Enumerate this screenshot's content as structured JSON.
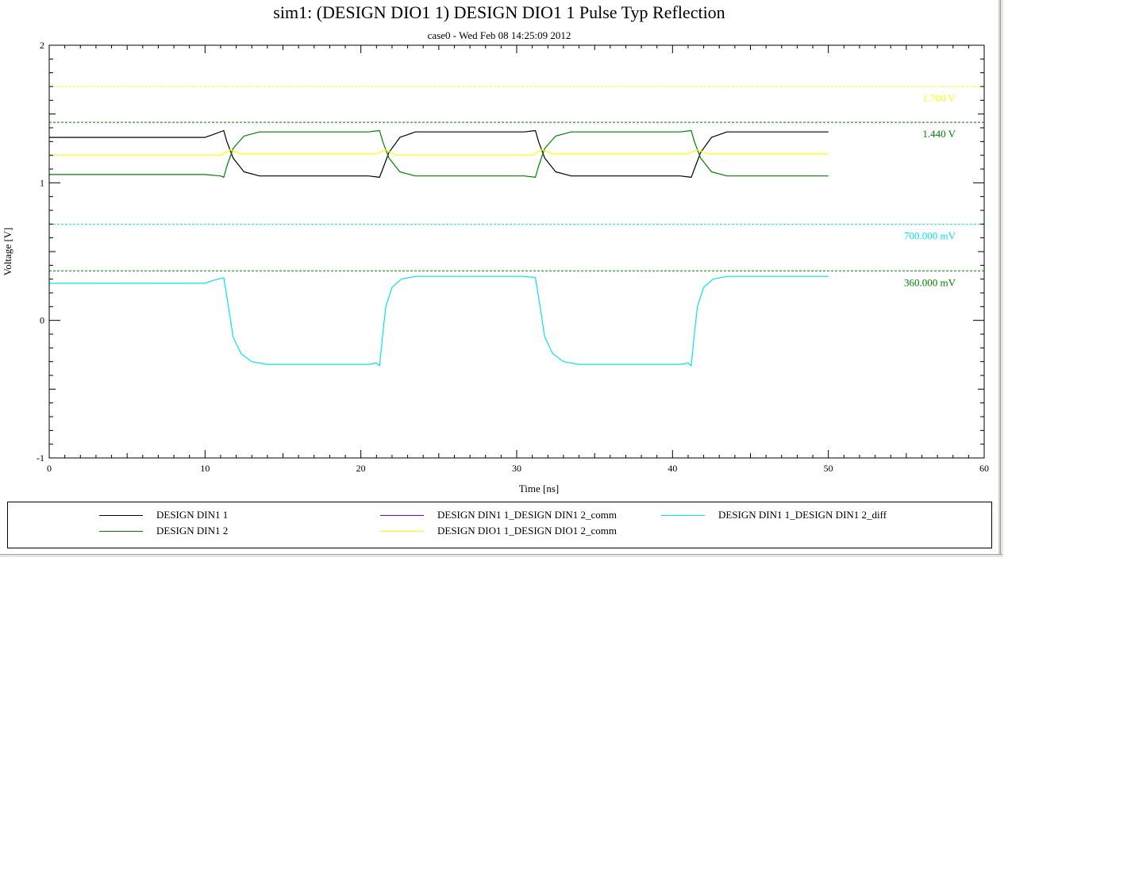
{
  "window": {
    "title": "sim1: (DESIGN DIO1 1) DESIGN DIO1 1 Pulse Typ Reflection",
    "subtitle": "case0 - Wed Feb 08 14:25:09 2012"
  },
  "chart_data": {
    "type": "line",
    "title": "sim1: (DESIGN DIO1 1) DESIGN DIO1 1 Pulse Typ Reflection",
    "subtitle": "case0 - Wed Feb 08 14:25:09 2012",
    "xlabel": "Time [ns]",
    "ylabel": "Voltage [V]",
    "xlim": [
      0,
      60
    ],
    "ylim": [
      -1,
      2
    ],
    "xticks": [
      0,
      10,
      20,
      30,
      40,
      50,
      60
    ],
    "yticks": [
      -1,
      0,
      1,
      2
    ],
    "grid": false,
    "legend_position": "bottom",
    "thresholds": [
      {
        "value": 1.7,
        "label": "1.700 V",
        "color": "#ffff00"
      },
      {
        "value": 1.44,
        "label": "1.440 V",
        "color": "#008000"
      },
      {
        "value": 0.7,
        "label": "700.000 mV",
        "color": "#00e5ee"
      },
      {
        "value": 0.36,
        "label": "360.000 mV",
        "color": "#008000"
      }
    ],
    "series": [
      {
        "name": "DESIGN DIN1 1",
        "color": "#000000",
        "x": [
          0,
          10,
          10.5,
          11.2,
          11.4,
          11.8,
          12.5,
          13.5,
          20.5,
          21.2,
          21.4,
          21.8,
          22.5,
          23.5,
          30.5,
          31.2,
          31.4,
          31.8,
          32.5,
          33.5,
          40.5,
          41.2,
          41.4,
          41.8,
          42.5,
          43.5,
          50
        ],
        "y": [
          1.33,
          1.33,
          1.35,
          1.38,
          1.3,
          1.18,
          1.08,
          1.05,
          1.05,
          1.04,
          1.1,
          1.22,
          1.33,
          1.37,
          1.37,
          1.38,
          1.3,
          1.18,
          1.08,
          1.05,
          1.05,
          1.04,
          1.1,
          1.22,
          1.33,
          1.37,
          1.37
        ]
      },
      {
        "name": "DESIGN DIN1 2",
        "color": "#008000",
        "x": [
          0,
          10,
          11,
          11.2,
          11.4,
          11.8,
          12.5,
          13.5,
          20.5,
          21.2,
          21.4,
          21.8,
          22.5,
          23.5,
          30.5,
          31.2,
          31.4,
          31.8,
          32.5,
          33.5,
          40.5,
          41.2,
          41.4,
          41.8,
          42.5,
          43.5,
          50
        ],
        "y": [
          1.06,
          1.06,
          1.05,
          1.04,
          1.12,
          1.25,
          1.34,
          1.37,
          1.37,
          1.38,
          1.3,
          1.18,
          1.08,
          1.05,
          1.05,
          1.04,
          1.12,
          1.25,
          1.34,
          1.37,
          1.37,
          1.38,
          1.3,
          1.18,
          1.08,
          1.05,
          1.05
        ]
      },
      {
        "name": "DESIGN DIN1 1_DESIGN DIN1 2_comm",
        "color": "#7b00c8",
        "x": [],
        "y": []
      },
      {
        "name": "DESIGN DIO1 1_DESIGN DIO1 2_comm",
        "color": "#ffff00",
        "x": [
          0,
          11,
          11.6,
          12.3,
          21,
          21.6,
          22.3,
          31,
          31.6,
          32.3,
          41,
          41.6,
          42.3,
          50
        ],
        "y": [
          1.2,
          1.2,
          1.24,
          1.21,
          1.21,
          1.24,
          1.2,
          1.2,
          1.24,
          1.21,
          1.21,
          1.24,
          1.21,
          1.21
        ]
      },
      {
        "name": "DESIGN DIN1 1_DESIGN DIN1 2_diff",
        "color": "#00e5ee",
        "x": [
          0,
          10,
          10.5,
          11.2,
          11.5,
          11.8,
          12.3,
          13,
          14,
          20.5,
          21,
          21.2,
          21.4,
          21.6,
          22,
          22.6,
          23.5,
          30.5,
          31.2,
          31.5,
          31.8,
          32.3,
          33,
          34,
          40.5,
          41,
          41.2,
          41.4,
          41.6,
          42,
          42.6,
          43.5,
          50
        ],
        "y": [
          0.27,
          0.27,
          0.29,
          0.31,
          0.1,
          -0.12,
          -0.24,
          -0.3,
          -0.32,
          -0.32,
          -0.31,
          -0.33,
          -0.1,
          0.1,
          0.24,
          0.3,
          0.32,
          0.32,
          0.31,
          0.1,
          -0.12,
          -0.24,
          -0.3,
          -0.32,
          -0.32,
          -0.31,
          -0.33,
          -0.1,
          0.1,
          0.24,
          0.3,
          0.32,
          0.32
        ]
      }
    ]
  },
  "legend": {
    "items": [
      {
        "label": "DESIGN DIN1 1",
        "color": "#000000"
      },
      {
        "label": "DESIGN DIN1 2",
        "color": "#008000"
      },
      {
        "label": "DESIGN DIN1 1_DESIGN DIN1 2_comm",
        "color": "#7b00c8"
      },
      {
        "label": "DESIGN DIO1 1_DESIGN DIO1 2_comm",
        "color": "#ffff00"
      },
      {
        "label": "DESIGN DIN1 1_DESIGN DIN1 2_diff",
        "color": "#00e5ee"
      }
    ]
  }
}
